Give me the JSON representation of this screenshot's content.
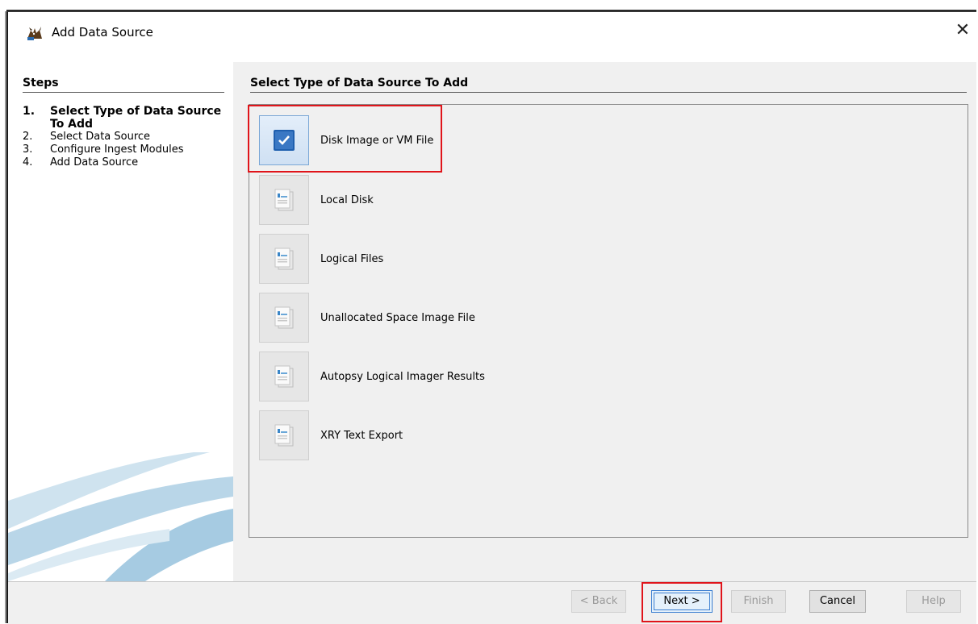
{
  "window": {
    "title": "Add Data Source",
    "close_glyph": "✕"
  },
  "sidebar": {
    "title": "Steps",
    "steps": [
      {
        "num": "1.",
        "label": "Select Type of Data Source To Add",
        "active": true
      },
      {
        "num": "2.",
        "label": "Select Data Source",
        "active": false
      },
      {
        "num": "3.",
        "label": "Configure Ingest Modules",
        "active": false
      },
      {
        "num": "4.",
        "label": "Add Data Source",
        "active": false
      }
    ]
  },
  "main": {
    "title": "Select Type of Data Source To Add",
    "types": [
      {
        "label": "Disk Image or VM File",
        "selected": true,
        "icon": "checkbox-checked-icon"
      },
      {
        "label": "Local Disk",
        "selected": false,
        "icon": "document-icon"
      },
      {
        "label": "Logical Files",
        "selected": false,
        "icon": "document-icon"
      },
      {
        "label": "Unallocated Space Image File",
        "selected": false,
        "icon": "document-icon"
      },
      {
        "label": "Autopsy Logical Imager Results",
        "selected": false,
        "icon": "document-icon"
      },
      {
        "label": "XRY Text Export",
        "selected": false,
        "icon": "document-icon"
      }
    ]
  },
  "footer": {
    "back_label": "< Back",
    "next_label": "Next >",
    "finish_label": "Finish",
    "cancel_label": "Cancel",
    "help_label": "Help"
  },
  "colors": {
    "highlight": "#e0141a",
    "accent": "#3c7fd1"
  }
}
